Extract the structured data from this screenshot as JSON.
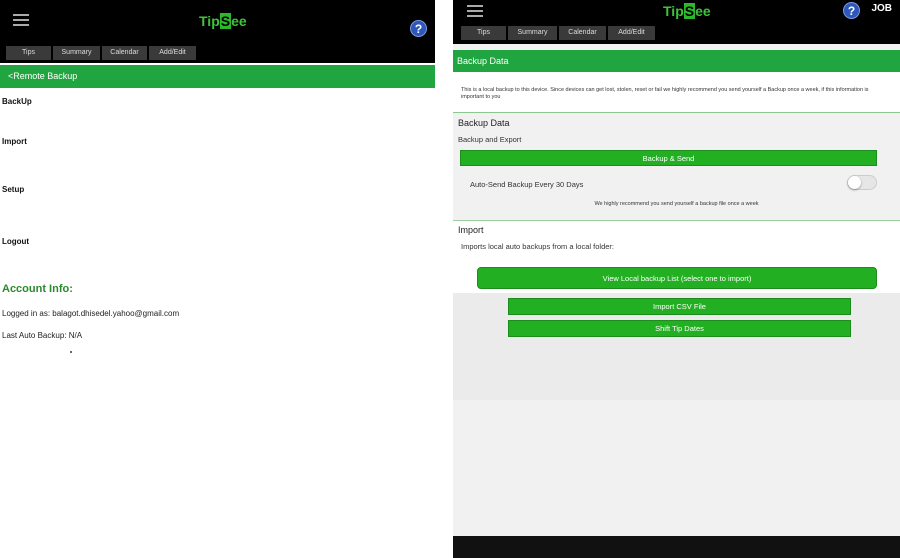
{
  "left": {
    "header": {
      "logo_prefix": "Tip",
      "logo_highlight": "S",
      "logo_suffix": "ee",
      "help_label": "?"
    },
    "tabs": [
      "Tips",
      "Summary",
      "Calendar",
      "Add/Edit"
    ],
    "back_link": "<Remote Backup",
    "items": [
      "BackUp",
      "Import",
      "Setup",
      "Logout"
    ],
    "account": {
      "title": "Account Info:",
      "logged_in": "Logged in as: balagot.dhisedel.yahoo@gmail.com",
      "last_backup": "Last Auto Backup: N/A"
    }
  },
  "right": {
    "header": {
      "logo_prefix": "Tip",
      "logo_highlight": "S",
      "logo_suffix": "ee",
      "help_label": "?",
      "job_label": "JOB"
    },
    "tabs": [
      "Tips",
      "Summary",
      "Calendar",
      "Add/Edit"
    ],
    "section_title": "Backup Data",
    "notice": "This is a local backup to this device. Since devices can get lost, stolen, reset or fail we highly recommend you send yourself a Backup once a week, if this information is important to you",
    "backup": {
      "title": "Backup Data",
      "subtitle": "Backup and Export",
      "send_button": "Backup & Send",
      "auto_send_label": "Auto-Send Backup Every 30 Days",
      "auto_send_on": false,
      "note": "We highly recommend you send yourself a backup file once a week"
    },
    "import": {
      "title": "Import",
      "description": "Imports local auto backups from a local folder:",
      "view_button": "View Local backup List (select one to import)",
      "csv_button": "Import CSV File",
      "shift_button": "Shift Tip Dates"
    }
  },
  "colors": {
    "accent_green": "#21a541",
    "button_green": "#22b022",
    "help_blue": "#2d57b8"
  }
}
